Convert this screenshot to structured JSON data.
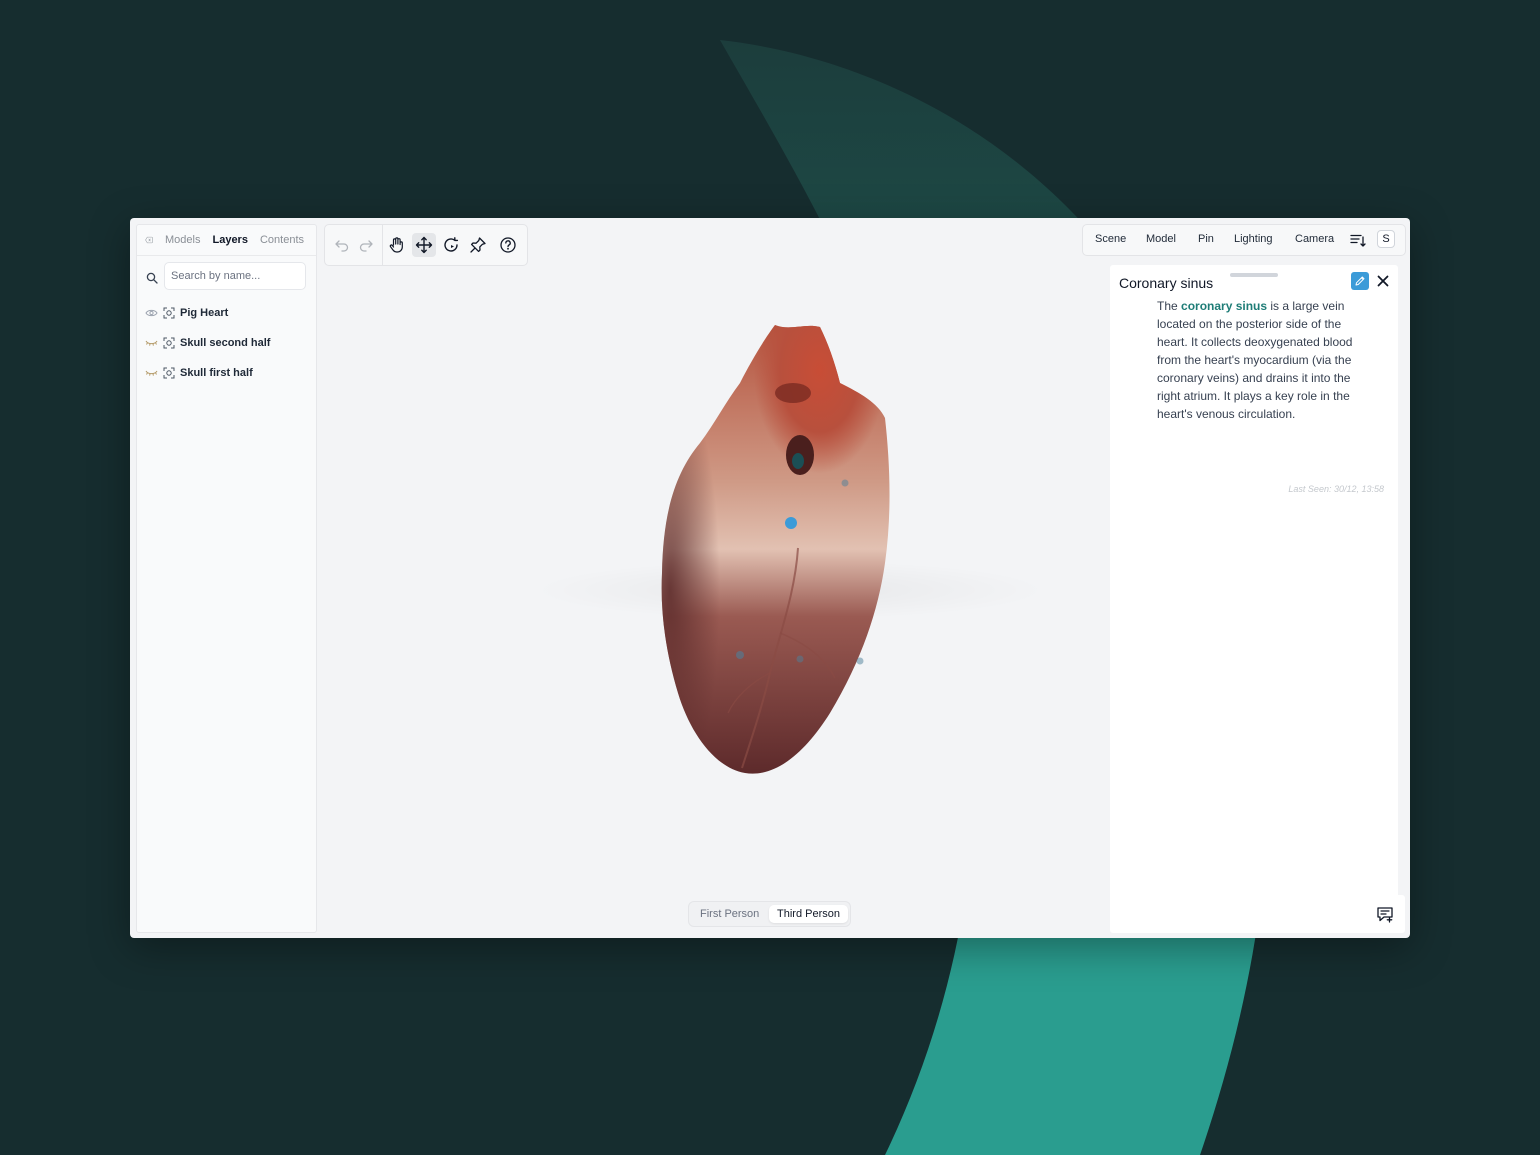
{
  "left_panel": {
    "tabs": [
      {
        "label": "Models",
        "active": false
      },
      {
        "label": "Layers",
        "active": true
      },
      {
        "label": "Contents",
        "active": false
      }
    ],
    "search_placeholder": "Search by name...",
    "layers": [
      {
        "label": "Pig Heart",
        "visible": true
      },
      {
        "label": "Skull second half",
        "visible": false
      },
      {
        "label": "Skull first half",
        "visible": false
      }
    ]
  },
  "toolbar": {
    "tools": [
      "undo-icon",
      "redo-icon",
      "hand-icon",
      "move-icon",
      "rotate-icon",
      "pin-icon",
      "help-icon"
    ],
    "active_tool": "move-icon"
  },
  "top_menu": {
    "items": [
      "Scene",
      "Model",
      "Pin",
      "Lighting",
      "Camera"
    ],
    "avatar": "S"
  },
  "info_panel": {
    "title": "Coronary sinus",
    "body_prefix": "The ",
    "body_highlight": "coronary sinus",
    "body_rest": " is a large vein located on the posterior side of the heart. It collects deoxygenated blood from the heart's myocardium (via the coronary veins) and drains it into the right atrium. It plays a key role in the heart's venous circulation.",
    "last_seen": "Last Seen: 30/12, 13:58"
  },
  "view_toggle": {
    "options": [
      "First Person",
      "Third Person"
    ],
    "active": "Third Person"
  },
  "colors": {
    "background": "#162d2f",
    "accent_teal": "#2a9d8f",
    "highlight_text": "#1f7d77",
    "pin_blue": "#3b9bd8"
  }
}
